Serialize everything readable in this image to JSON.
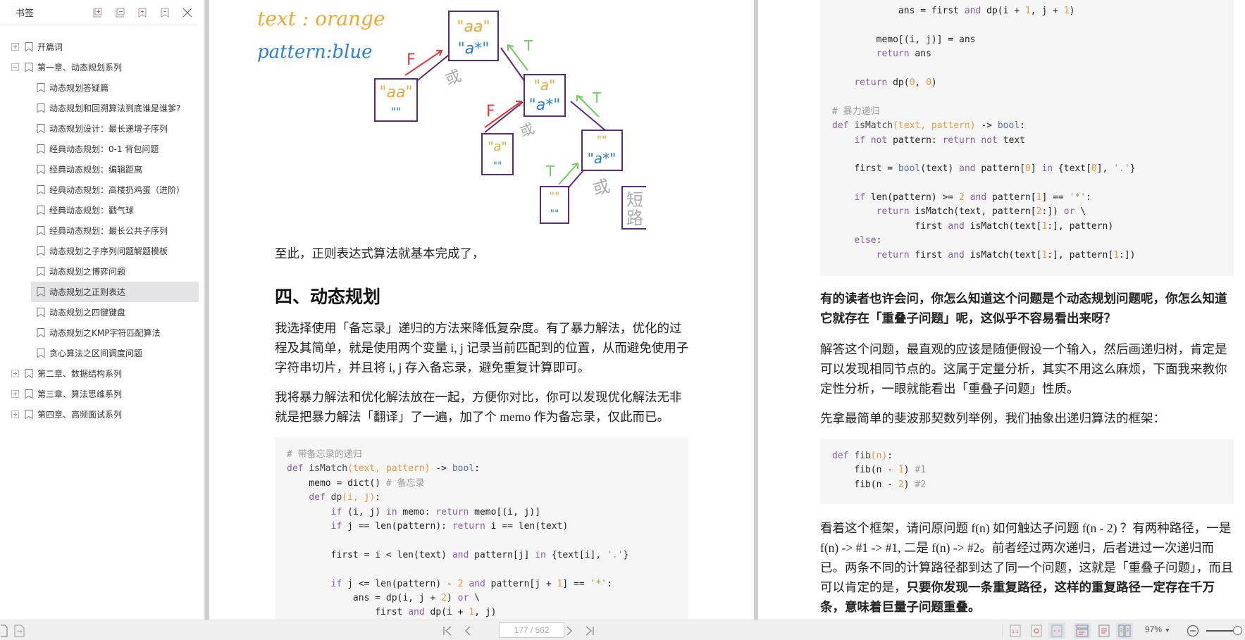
{
  "sidebar": {
    "title": "书签",
    "tools": [
      "expand-all",
      "collapse-all",
      "add-bookmark",
      "remove-bookmark",
      "close"
    ],
    "items": [
      {
        "label": "开篇词",
        "level": 0,
        "expander": "plus"
      },
      {
        "label": "第一章、动态规划系列",
        "level": 0,
        "expander": "minus"
      },
      {
        "label": "动态规划答疑篇",
        "level": 1
      },
      {
        "label": "动态规划和回溯算法到底谁是谁爹?",
        "level": 1
      },
      {
        "label": "动态规划设计：最长递增子序列",
        "level": 1
      },
      {
        "label": "经典动态规划：0-1 背包问题",
        "level": 1
      },
      {
        "label": "经典动态规划：编辑距离",
        "level": 1
      },
      {
        "label": "经典动态规划：高楼扔鸡蛋（进阶）",
        "level": 1
      },
      {
        "label": "经典动态规划：戳气球",
        "level": 1
      },
      {
        "label": "经典动态规划：最长公共子序列",
        "level": 1
      },
      {
        "label": "动态规划之子序列问题解题模板",
        "level": 1
      },
      {
        "label": "动态规划之博弈问题",
        "level": 1
      },
      {
        "label": "动态规划之正则表达",
        "level": 1,
        "selected": true
      },
      {
        "label": "动态规划之四键键盘",
        "level": 1
      },
      {
        "label": "动态规划之KMP字符匹配算法",
        "level": 1
      },
      {
        "label": "贪心算法之区间调度问题",
        "level": 1
      },
      {
        "label": "第二章、数据结构系列",
        "level": 0,
        "expander": "plus"
      },
      {
        "label": "第三章、算法思维系列",
        "level": 0,
        "expander": "plus"
      },
      {
        "label": "第四章、高频面试系列",
        "level": 0,
        "expander": "plus"
      }
    ]
  },
  "diagram": {
    "legend_text": "text : orange",
    "legend_pattern": "pattern:blue",
    "nodes": [
      {
        "text": "\"aa\"",
        "pattern": "\"a*\""
      },
      {
        "text": "\"aa\"",
        "pattern": "\"\""
      },
      {
        "text": "\"a\"",
        "pattern": "\"a*\""
      },
      {
        "text": "\"a\"",
        "pattern": "\"\""
      },
      {
        "text": "\"\"",
        "pattern": "\"a*\""
      },
      {
        "text": "\"\"",
        "pattern": "\"\""
      }
    ],
    "edge_false": "F",
    "edge_true": "T",
    "or_label": "或",
    "short_circuit": "短路",
    "colors": {
      "text": "#f0a830",
      "pattern": "#2a7fd6",
      "box": "#5a2a82",
      "false": "#e03a3a",
      "true": "#6ccf5a",
      "note": "#aaaaaa"
    }
  },
  "left_page": {
    "p1": "至此，正则表达式算法就基本完成了，",
    "heading": "四、动态规划",
    "p2": "我选择使用「备忘录」递归的方法来降低复杂度。有了暴力解法，优化的过程及其简单，就是使用两个变量 i, j 记录当前匹配到的位置，从而避免使用子字符串切片，并且将 i, j 存入备忘录，避免重复计算即可。",
    "p3": "我将暴力解法和优化解法放在一起，方便你对比，你可以发现优化解法无非就是把暴力解法「翻译」了一遍，加了个 memo 作为备忘录，仅此而已。",
    "code_lines": [
      "# 带备忘录的递归",
      "def isMatch(text, pattern) -> bool:",
      "    memo = dict() # 备忘录",
      "    def dp(i, j):",
      "        if (i, j) in memo: return memo[(i, j)]",
      "        if j == len(pattern): return i == len(text)",
      "",
      "        first = i < len(text) and pattern[j] in {text[i], '.'}",
      "",
      "        if j <= len(pattern) - 2 and pattern[j + 1] == '*':",
      "            ans = dp(i, j + 2) or \\",
      "                first and dp(i + 1, j)"
    ]
  },
  "right_page": {
    "code_lines": [
      "            ans = first and dp(i + 1, j + 1)",
      "",
      "        memo[(i, j)] = ans",
      "        return ans",
      "",
      "    return dp(0, 0)",
      "",
      "# 暴力递归",
      "def isMatch(text, pattern) -> bool:",
      "    if not pattern: return not text",
      "",
      "    first = bool(text) and pattern[0] in {text[0], '.'}",
      "",
      "    if len(pattern) >= 2 and pattern[1] == '*':",
      "        return isMatch(text, pattern[2:]) or \\",
      "               first and isMatch(text[1:], pattern)",
      "    else:",
      "        return first and isMatch(text[1:], pattern[1:])"
    ],
    "q_bold": "有的读者也许会问，你怎么知道这个问题是个动态规划问题呢，你怎么知道它就存在「重叠子问题」呢，这似乎不容易看出来呀？",
    "p1": "解答这个问题，最直观的应该是随便假设一个输入，然后画递归树，肯定是可以发现相同节点的。这属于定量分析，其实不用这么麻烦，下面我来教你定性分析，一眼就能看出「重叠子问题」性质。",
    "p2": "先拿最简单的斐波那契数列举例，我们抽象出递归算法的框架：",
    "fib_lines": [
      "def fib(n):",
      "    fib(n - 1) #1",
      "    fib(n - 2) #2"
    ],
    "p3_normal": "看着这个框架，请问原问题 f(n) 如何触达子问题 f(n - 2) ？有两种路径，一是 f(n) -> #1 -> #1, 二是 f(n) -> #2。前者经过两次递归，后者进过一次递归而已。两条不同的计算路径都到达了同一个问题，这就是「重叠子问题」，而且可以肯定的是，",
    "p3_bold": "只要你发现一条重复路径，这样的重复路径一定存在千万条，意味着巨量子问题重叠。"
  },
  "statusbar": {
    "page_indicator": "177 / 562",
    "zoom": "97%",
    "zoom_percent": 97
  }
}
